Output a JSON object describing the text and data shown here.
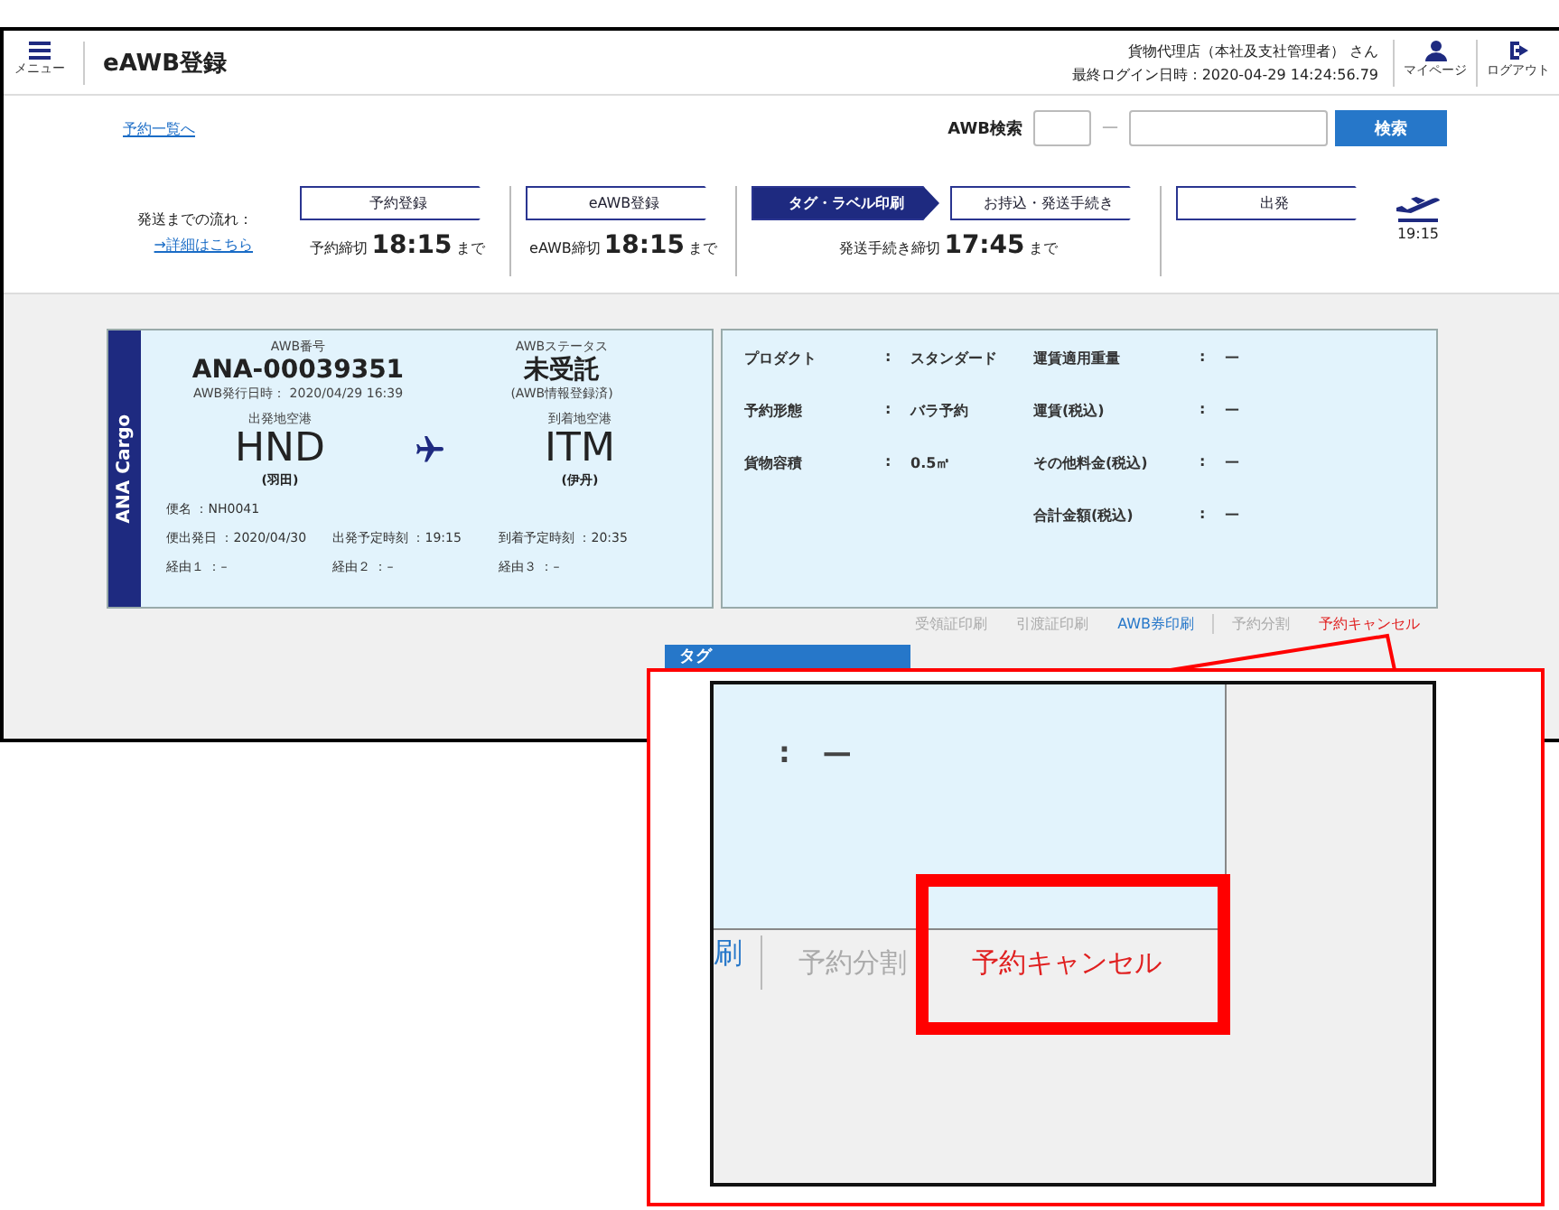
{
  "header": {
    "menu_label": "メニュー",
    "title": "eAWB登録",
    "user": "貨物代理店（本社及支社管理者） さん",
    "last_login": "最終ログイン日時：2020-04-29 14:24:56.79",
    "actions": [
      {
        "kind": "user",
        "label": "マイページ"
      },
      {
        "kind": "logout",
        "label": "ログアウト"
      }
    ]
  },
  "toolbar": {
    "back_link": "予約一覧へ",
    "search_label": "AWB検索",
    "dash": "—",
    "search_button": "検索"
  },
  "flow": {
    "label": "発送までの流れ：",
    "detail_link": "→詳細はこちら",
    "departure_time": "19:15",
    "sections": [
      {
        "steps": [
          {
            "label": "予約登録",
            "selected": false
          }
        ],
        "deadline": {
          "label": "予約締切",
          "time": "18:15",
          "suffix": "まで"
        }
      },
      {
        "steps": [
          {
            "label": "eAWB登録",
            "selected": false
          }
        ],
        "deadline": {
          "label": "eAWB締切",
          "time": "18:15",
          "suffix": "まで"
        }
      },
      {
        "steps": [
          {
            "label": "タグ・ラベル印刷",
            "selected": true
          },
          {
            "label": "お持込・発送手続き",
            "selected": false
          }
        ],
        "deadline": {
          "label": "発送手続き締切",
          "time": "17:45",
          "suffix": "まで"
        }
      },
      {
        "steps": [
          {
            "label": "出発",
            "selected": false
          }
        ]
      }
    ]
  },
  "awb": {
    "carrier": "ANA Cargo",
    "number_label": "AWB番号",
    "number": "ANA-00039351",
    "issued": "AWB発行日時： 2020/04/29 16:39",
    "status_label": "AWBステータス",
    "status": "未受託",
    "status_note": "(AWB情報登録済)",
    "origin": {
      "label": "出発地空港",
      "code": "HND",
      "name": "(羽田)"
    },
    "destination": {
      "label": "到着地空港",
      "code": "ITM",
      "name": "(伊丹)"
    },
    "flight_rows": [
      [
        {
          "label": "便名",
          "value": "：NH0041"
        }
      ],
      [
        {
          "label": "便出発日",
          "value": "：2020/04/30"
        },
        {
          "label": "出発予定時刻",
          "value": "：19:15"
        },
        {
          "label": "到着予定時刻",
          "value": "：20:35"
        }
      ],
      [
        {
          "label": "経由１",
          "value": "：–"
        },
        {
          "label": "経由２",
          "value": "：–"
        },
        {
          "label": "経由３",
          "value": "：–"
        }
      ]
    ]
  },
  "details": {
    "columns": [
      [
        {
          "label": "プロダクト",
          "sep": ":",
          "value": "スタンダード"
        },
        {
          "label": "予約形態",
          "sep": ":",
          "value": "バラ予約"
        },
        {
          "label": "貨物容積",
          "sep": ":",
          "value": "0.5㎥"
        }
      ],
      [
        {
          "label": "運賃適用重量",
          "sep": ":",
          "value": "—"
        },
        {
          "label": "運賃(税込)",
          "sep": ":",
          "value": "—"
        },
        {
          "label": "その他料金(税込)",
          "sep": ":",
          "value": "—"
        },
        {
          "label": "合計金額(税込)",
          "sep": ":",
          "value": "—"
        }
      ]
    ]
  },
  "action_groups": [
    [
      {
        "label": "受領証印刷",
        "kind": "link",
        "disabled": true
      },
      {
        "label": "引渡証印刷",
        "kind": "link",
        "disabled": true
      },
      {
        "label": "AWB券印刷",
        "kind": "link",
        "disabled": false
      }
    ],
    [
      {
        "label": "予約分割",
        "kind": "link",
        "disabled": true
      },
      {
        "label": "予約キャンセル",
        "kind": "danger",
        "disabled": false
      }
    ]
  ],
  "download_button": "タグ",
  "callout": {
    "sep": ":",
    "value": "—",
    "partial_link": "刷",
    "actions": [
      {
        "label": "予約分割",
        "kind": "link",
        "disabled": true,
        "highlighted": false
      },
      {
        "label": "予約キャンセル",
        "kind": "danger",
        "disabled": false,
        "highlighted": true
      }
    ]
  }
}
